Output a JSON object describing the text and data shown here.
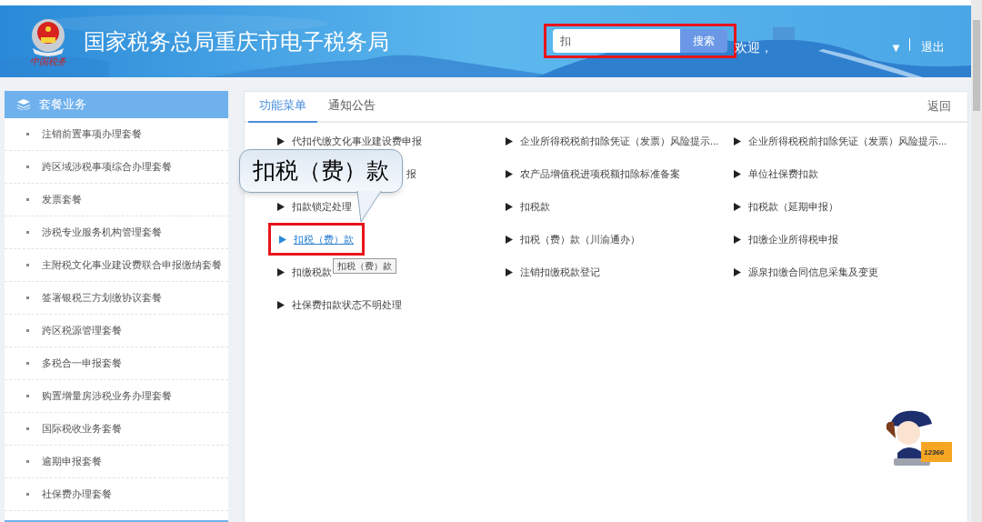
{
  "header": {
    "title": "国家税务总局重庆市电子税务局",
    "logo_caption": "中国税务",
    "search": {
      "value": "扣",
      "button": "搜索"
    },
    "welcome": "欢迎，",
    "menu_caret": "▼",
    "logout": "退出"
  },
  "sidebar": {
    "title": "套餐业务",
    "items": [
      {
        "label": "注销前置事项办理套餐"
      },
      {
        "label": "跨区域涉税事项综合办理套餐"
      },
      {
        "label": "发票套餐"
      },
      {
        "label": "涉税专业服务机构管理套餐"
      },
      {
        "label": "主附税文化事业建设费联合申报缴纳套餐"
      },
      {
        "label": "签署银税三方划缴协议套餐"
      },
      {
        "label": "跨区税源管理套餐"
      },
      {
        "label": "多税合一申报套餐"
      },
      {
        "label": "购置增量房涉税业务办理套餐"
      },
      {
        "label": "国际税收业务套餐"
      },
      {
        "label": "逾期申报套餐"
      },
      {
        "label": "社保费办理套餐"
      }
    ]
  },
  "tabs": [
    {
      "label": "功能菜单",
      "selected": true
    },
    {
      "label": "通知公告",
      "selected": false
    }
  ],
  "back": "返回",
  "menu_columns": [
    [
      {
        "kind": "link",
        "label": "代扣代缴文化事业建设费申报",
        "selected": false
      },
      {
        "kind": "fragment",
        "label": "报"
      },
      {
        "kind": "link",
        "label": "扣款锁定处理",
        "selected": false
      },
      {
        "kind": "link",
        "label": "扣税（费）款",
        "selected": true
      },
      {
        "kind": "link",
        "label": "扣缴税款",
        "selected": false
      },
      {
        "kind": "link",
        "label": "社保费扣款状态不明处理",
        "selected": false
      }
    ],
    [
      {
        "kind": "link",
        "label": "企业所得税税前扣除凭证（发票）风险提示...",
        "selected": false
      },
      {
        "kind": "link",
        "label": "农产品增值税进项税额扣除标准备案",
        "selected": false
      },
      {
        "kind": "link",
        "label": "扣税款",
        "selected": false
      },
      {
        "kind": "link",
        "label": "扣税（费）款（川渝通办）",
        "selected": false
      },
      {
        "kind": "link",
        "label": "注销扣缴税款登记",
        "selected": false
      }
    ],
    [
      {
        "kind": "link",
        "label": "企业所得税税前扣除凭证（发票）风险提示...",
        "selected": false
      },
      {
        "kind": "link",
        "label": "单位社保费扣款",
        "selected": false
      },
      {
        "kind": "link",
        "label": "扣税款（延期申报）",
        "selected": false
      },
      {
        "kind": "link",
        "label": "扣缴企业所得税申报",
        "selected": false
      },
      {
        "kind": "link",
        "label": "源泉扣缴合同信息采集及变更",
        "selected": false
      }
    ]
  ],
  "callout": "扣税（费）款",
  "tooltip": "扣税（费）款",
  "assistant": {
    "laptop_label": "12366"
  }
}
